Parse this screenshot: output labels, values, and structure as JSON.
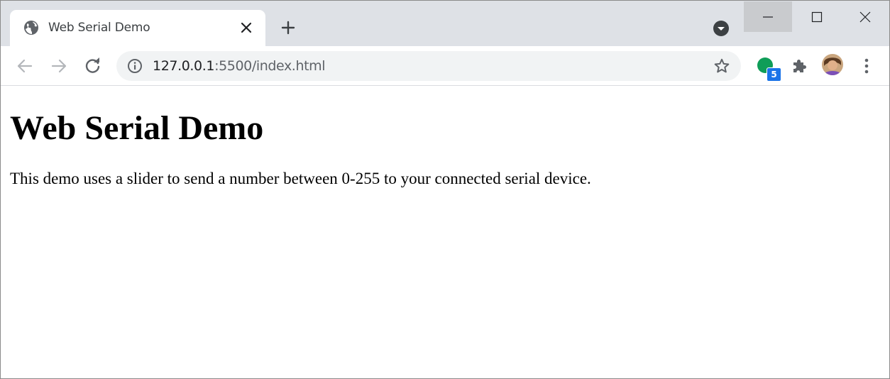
{
  "tab": {
    "title": "Web Serial Demo",
    "favicon_icon": "globe-icon",
    "close_icon": "close-icon"
  },
  "tabstrip": {
    "new_tab_icon": "plus-icon",
    "tab_search_icon": "chevron-down-icon"
  },
  "window_controls": {
    "minimize_icon": "minimize-icon",
    "maximize_icon": "maximize-icon",
    "close_icon": "close-icon"
  },
  "toolbar": {
    "back_icon": "arrow-left-icon",
    "forward_icon": "arrow-right-icon",
    "reload_icon": "reload-icon",
    "info_icon": "info-icon",
    "url_host": "127.0.0.1",
    "url_path": ":5500/index.html",
    "bookmark_icon": "star-icon",
    "extension_badge": "5",
    "extensions_icon": "puzzle-icon",
    "menu_icon": "kebab-menu-icon"
  },
  "page": {
    "heading": "Web Serial Demo",
    "description": "This demo uses a slider to send a number between 0-255 to your connected serial device."
  },
  "colors": {
    "tabstrip_bg": "#dee1e6",
    "omnibox_bg": "#f1f3f4",
    "extension_green": "#0f9d58",
    "badge_blue": "#1a73e8"
  }
}
